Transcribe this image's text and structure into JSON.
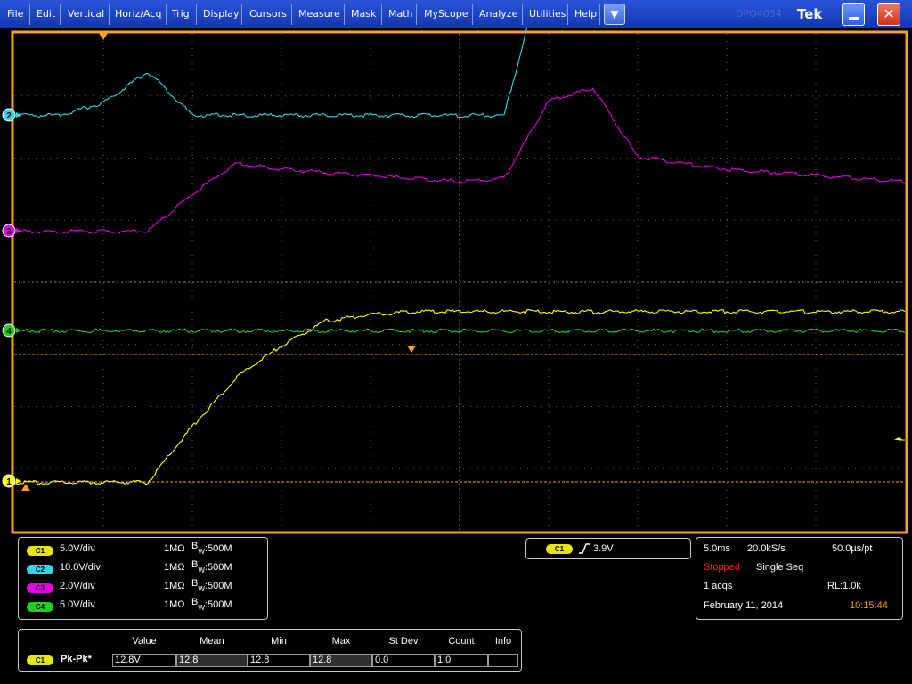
{
  "menu": {
    "items": [
      "File",
      "Edit",
      "Vertical",
      "Horiz/Acq",
      "Trig",
      "Display",
      "Cursors",
      "Measure",
      "Mask",
      "Math",
      "MyScope",
      "Analyze",
      "Utilities",
      "Help"
    ],
    "dropdown_icon": "chevron-down-icon",
    "faint_label": "DPO4054",
    "brand": "Tek",
    "minimize_icon": "minimize-icon",
    "close_icon": "close-icon"
  },
  "display": {
    "grid": true,
    "colors": {
      "ch1": "#ffff00",
      "ch2": "#33d6e8",
      "ch3": "#e100e1",
      "ch4": "#22cc22",
      "frame": "#f4a030",
      "grid": "#6a6a6a",
      "cursor": "#f4a030"
    }
  },
  "chart_data": {
    "type": "line",
    "grid": true,
    "x": [
      0,
      0.5,
      1,
      1.5,
      2,
      2.5,
      3,
      3.5,
      4,
      4.5,
      5,
      5.5,
      6,
      6.5,
      7,
      7.5,
      8,
      8.5,
      9,
      9.5,
      10
    ],
    "series": [
      {
        "channel": "1",
        "color": "#ffff00",
        "values": [
          0,
          0,
          0,
          0,
          0.9,
          1.7,
          2.2,
          2.6,
          2.7,
          2.75,
          2.75,
          2.75,
          2.75,
          2.75,
          2.75,
          2.75,
          2.75,
          2.75,
          2.75,
          2.75,
          2.75
        ]
      },
      {
        "channel": "2",
        "color": "#33d6e8",
        "values": [
          0,
          0,
          0.2,
          0.7,
          0,
          0,
          0,
          0,
          0,
          0,
          0,
          0,
          2.7,
          2.7,
          2.7,
          2.7,
          2.7,
          2.7,
          2.7,
          2.7,
          2.7
        ]
      },
      {
        "channel": "3",
        "color": "#e100e1",
        "values": [
          0,
          0,
          0,
          0,
          0.6,
          1.1,
          1.0,
          0.95,
          0.9,
          0.85,
          0.8,
          0.85,
          2.1,
          2.3,
          1.2,
          1.1,
          1.0,
          0.95,
          0.9,
          0.85,
          0.8
        ]
      },
      {
        "channel": "4",
        "color": "#22cc22",
        "values": [
          0,
          0,
          0,
          0,
          0,
          0,
          0,
          0,
          0,
          0,
          0,
          0,
          0,
          0,
          0,
          0,
          0,
          0,
          0,
          0,
          0
        ]
      }
    ]
  },
  "markers": {
    "ch1": "1",
    "ch2": "2",
    "ch3": "3",
    "ch4": "4"
  },
  "channels": [
    {
      "label": "C1",
      "scale": "5.0V/div",
      "impedance": "1MΩ",
      "bw_sup": "B",
      "bw_sub": "W",
      "bw_val": ":500M",
      "badge_color": "#e6e600"
    },
    {
      "label": "C2",
      "scale": "10.0V/div",
      "impedance": "1MΩ",
      "bw_sup": "B",
      "bw_sub": "W",
      "bw_val": ":500M",
      "badge_color": "#33d6e8"
    },
    {
      "label": "C3",
      "scale": "2.0V/div",
      "impedance": "1MΩ",
      "bw_sup": "B",
      "bw_sub": "W",
      "bw_val": ":500M",
      "badge_color": "#e100e1"
    },
    {
      "label": "C4",
      "scale": "5.0V/div",
      "impedance": "1MΩ",
      "bw_sup": "B",
      "bw_sub": "W",
      "bw_val": ":500M",
      "badge_color": "#22cc22"
    }
  ],
  "trigger": {
    "source": "C1",
    "level": "3.9V",
    "slope_icon": "rising-edge-icon"
  },
  "acq": {
    "timebase": "5.0ms",
    "sample_rate": "20.0kS/s",
    "per_pt": "50.0µs/pt",
    "state": "Stopped",
    "mode": "Single Seq",
    "acqs": "1 acqs",
    "record_length": "RL:1.0k",
    "date": "February 11, 2014",
    "time": "10:15:44",
    "state_color": "#ff2020",
    "time_color": "#ff9a1a"
  },
  "measurements": {
    "headers": [
      "Value",
      "Mean",
      "Min",
      "Max",
      "St Dev",
      "Count",
      "Info"
    ],
    "rows": [
      {
        "source": "C1",
        "name": "Pk-Pk*",
        "values": [
          "12.8V",
          "12.8",
          "12.8",
          "12.8",
          "0.0",
          "1.0",
          ""
        ]
      }
    ]
  }
}
